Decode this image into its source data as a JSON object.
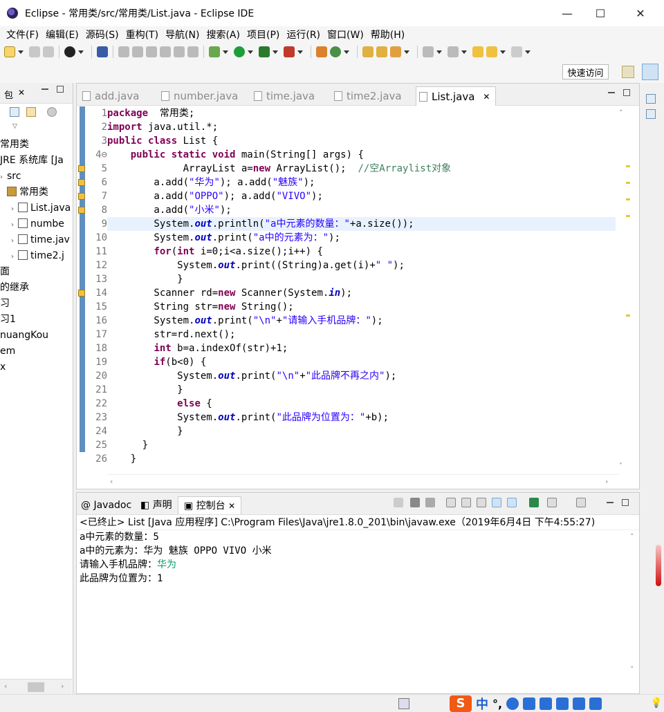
{
  "window": {
    "title": "Eclipse - 常用类/src/常用类/List.java - Eclipse IDE",
    "minimize": "—",
    "maximize": "☐",
    "close": "✕"
  },
  "menu": [
    "文件(F)",
    "编辑(E)",
    "源码(S)",
    "重构(T)",
    "导航(N)",
    "搜索(A)",
    "项目(P)",
    "运行(R)",
    "窗口(W)",
    "帮助(H)"
  ],
  "quick_access": "快速访问",
  "package_explorer": {
    "title": "包",
    "tree": [
      {
        "label": "常用类",
        "arrow": "",
        "indent": 0
      },
      {
        "label": "JRE 系统库 [Ja",
        "arrow": "",
        "indent": 0
      },
      {
        "label": "src",
        "arrow": "›",
        "indent": 0
      },
      {
        "label": "常用类",
        "arrow": "",
        "indent": 10
      },
      {
        "label": "List.java",
        "arrow": "›",
        "indent": 16
      },
      {
        "label": "numbe",
        "arrow": "›",
        "indent": 16
      },
      {
        "label": "time.jav",
        "arrow": "›",
        "indent": 16
      },
      {
        "label": "time2.j",
        "arrow": "›",
        "indent": 16
      },
      {
        "label": "面",
        "arrow": "",
        "indent": 0
      },
      {
        "label": "的继承",
        "arrow": "",
        "indent": 0
      },
      {
        "label": "习",
        "arrow": "",
        "indent": 0
      },
      {
        "label": "习1",
        "arrow": "",
        "indent": 0
      },
      {
        "label": "nuangKou",
        "arrow": "",
        "indent": 0
      },
      {
        "label": "em",
        "arrow": "",
        "indent": 0
      },
      {
        "label": "x",
        "arrow": "",
        "indent": 0
      }
    ]
  },
  "editor": {
    "tabs": [
      {
        "label": "add.java",
        "active": false
      },
      {
        "label": "number.java",
        "active": false
      },
      {
        "label": "time.java",
        "active": false
      },
      {
        "label": "time2.java",
        "active": false
      },
      {
        "label": "List.java",
        "active": true
      }
    ],
    "current_line": 9,
    "lines": [
      [
        [
          "kw",
          "package"
        ],
        [
          "",
          "  常用类;"
        ]
      ],
      [
        [
          "kw",
          "import"
        ],
        [
          "",
          " java.util.*;"
        ]
      ],
      [
        [
          "kw",
          "public class"
        ],
        [
          "",
          " List {"
        ]
      ],
      [
        [
          "",
          "    "
        ],
        [
          "kw",
          "public static void"
        ],
        [
          "",
          " main(String[] args) {"
        ]
      ],
      [
        [
          "",
          "             ArrayList a="
        ],
        [
          "kw",
          "new"
        ],
        [
          "",
          " ArrayList();  "
        ],
        [
          "cmt",
          "//空Arraylist对象"
        ]
      ],
      [
        [
          "",
          "        a.add("
        ],
        [
          "str",
          "\"华为\""
        ],
        [
          "",
          "); a.add("
        ],
        [
          "str",
          "\"魅族\""
        ],
        [
          "",
          ");"
        ]
      ],
      [
        [
          "",
          "        a.add("
        ],
        [
          "str",
          "\"OPPO\""
        ],
        [
          "",
          "); a.add("
        ],
        [
          "str",
          "\"VIVO\""
        ],
        [
          "",
          ");"
        ]
      ],
      [
        [
          "",
          "        a.add("
        ],
        [
          "str",
          "\"小米\""
        ],
        [
          "",
          ");"
        ]
      ],
      [
        [
          "",
          "        System."
        ],
        [
          "fld",
          "out"
        ],
        [
          "",
          ".println("
        ],
        [
          "str",
          "\"a中元素的数量：\""
        ],
        [
          "",
          "+a.size());"
        ]
      ],
      [
        [
          "",
          "        System."
        ],
        [
          "fld",
          "out"
        ],
        [
          "",
          ".print("
        ],
        [
          "str",
          "\"a中的元素为：\""
        ],
        [
          "",
          ");"
        ]
      ],
      [
        [
          "",
          "        "
        ],
        [
          "kw",
          "for"
        ],
        [
          "",
          "("
        ],
        [
          "kw",
          "int"
        ],
        [
          "",
          " i=0;i<a.size();i++) {"
        ]
      ],
      [
        [
          "",
          "            System."
        ],
        [
          "fld",
          "out"
        ],
        [
          "",
          ".print((String)a.get(i)+"
        ],
        [
          "str",
          "\" \""
        ],
        [
          "",
          ");"
        ]
      ],
      [
        [
          "",
          "            }"
        ]
      ],
      [
        [
          "",
          "        Scanner rd="
        ],
        [
          "kw",
          "new"
        ],
        [
          "",
          " Scanner(System."
        ],
        [
          "fld",
          "in"
        ],
        [
          "",
          ");"
        ]
      ],
      [
        [
          "",
          "        String str="
        ],
        [
          "kw",
          "new"
        ],
        [
          "",
          " String();"
        ]
      ],
      [
        [
          "",
          "        System."
        ],
        [
          "fld",
          "out"
        ],
        [
          "",
          ".print("
        ],
        [
          "str",
          "\"\\n\""
        ],
        [
          "",
          "+"
        ],
        [
          "str",
          "\"请输入手机品牌：\""
        ],
        [
          "",
          ");"
        ]
      ],
      [
        [
          "",
          "        str=rd.next();"
        ]
      ],
      [
        [
          "",
          "        "
        ],
        [
          "kw",
          "int"
        ],
        [
          "",
          " b=a.indexOf(str)+1;"
        ]
      ],
      [
        [
          "",
          "        "
        ],
        [
          "kw",
          "if"
        ],
        [
          "",
          "(b<0) {"
        ]
      ],
      [
        [
          "",
          "            System."
        ],
        [
          "fld",
          "out"
        ],
        [
          "",
          ".print("
        ],
        [
          "str",
          "\"\\n\""
        ],
        [
          "",
          "+"
        ],
        [
          "str",
          "\"此品牌不再之内\""
        ],
        [
          "",
          ");"
        ]
      ],
      [
        [
          "",
          "            }"
        ]
      ],
      [
        [
          "",
          "            "
        ],
        [
          "kw",
          "else"
        ],
        [
          "",
          " {"
        ]
      ],
      [
        [
          "",
          "            System."
        ],
        [
          "fld",
          "out"
        ],
        [
          "",
          ".print("
        ],
        [
          "str",
          "\"此品牌为位置为：\""
        ],
        [
          "",
          "+b);"
        ]
      ],
      [
        [
          "",
          "            }"
        ]
      ],
      [
        [
          "",
          "      }"
        ]
      ],
      [
        [
          "",
          "    }"
        ]
      ]
    ]
  },
  "console": {
    "tabs": [
      "Javadoc",
      "声明",
      "控制台"
    ],
    "status": "<已终止> List [Java 应用程序] C:\\Program Files\\Java\\jre1.8.0_201\\bin\\javaw.exe（2019年6月4日 下午4:55:27)",
    "output": [
      {
        "text": "a中元素的数量：5",
        "kind": "out"
      },
      {
        "text": "a中的元素为：华为 魅族 OPPO VIVO 小米",
        "kind": "out"
      },
      {
        "prompt": "请输入手机品牌：",
        "input": "华为",
        "kind": "mixed"
      },
      {
        "text": "此品牌为位置为：1",
        "kind": "out"
      }
    ]
  },
  "ime": {
    "logo": "S",
    "lang": "中",
    "punct": "°,"
  }
}
